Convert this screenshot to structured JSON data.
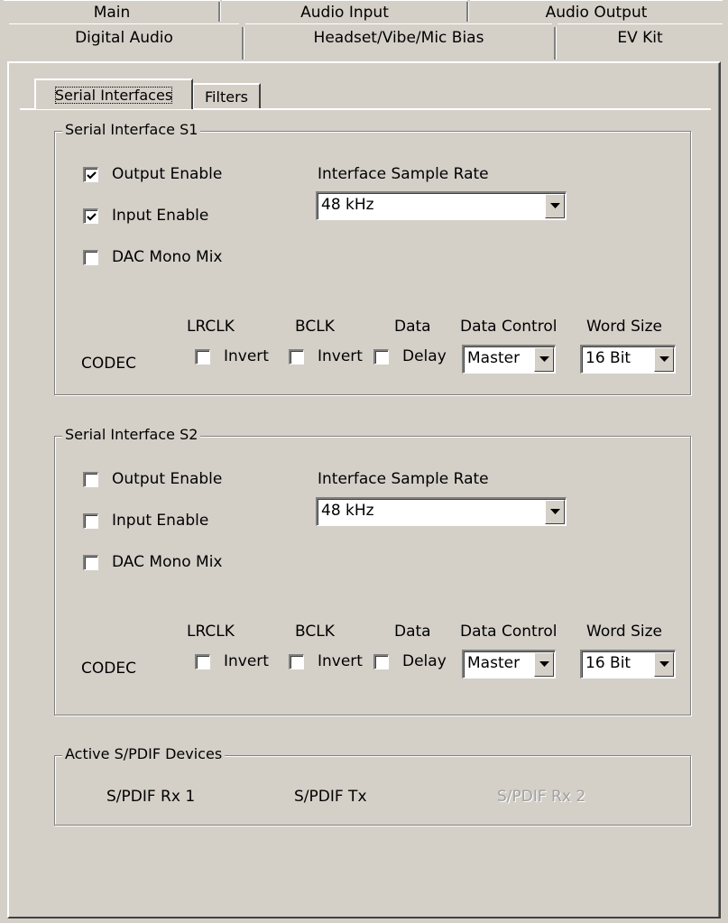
{
  "tabs_row1": [
    "Main",
    "Audio Input",
    "Audio Output"
  ],
  "tabs_row2": [
    "Digital Audio",
    "Headset/Vibe/Mic Bias",
    "EV Kit"
  ],
  "active_tab": "Digital Audio",
  "subtabs": [
    "Serial Interfaces",
    "Filters"
  ],
  "active_subtab": "Serial Interfaces",
  "s1": {
    "title": "Serial Interface  S1",
    "output_enable": {
      "label": "Output Enable",
      "checked": true
    },
    "input_enable": {
      "label": "Input Enable",
      "checked": true
    },
    "dac_mono_mix": {
      "label": "DAC Mono Mix",
      "checked": false
    },
    "sample_rate_label": "Interface Sample Rate",
    "sample_rate": "48 kHz",
    "codec_label": "CODEC",
    "lrclk_label": "LRCLK",
    "lrclk_invert": {
      "label": "Invert",
      "checked": false
    },
    "bclk_label": "BCLK",
    "bclk_invert": {
      "label": "Invert",
      "checked": false
    },
    "data_label": "Data",
    "data_delay": {
      "label": "Delay",
      "checked": false
    },
    "data_control_label": "Data Control",
    "data_control": "Master",
    "word_size_label": "Word Size",
    "word_size": "16 Bit"
  },
  "s2": {
    "title": "Serial Interface  S2",
    "output_enable": {
      "label": "Output Enable",
      "checked": false
    },
    "input_enable": {
      "label": "Input Enable",
      "checked": false
    },
    "dac_mono_mix": {
      "label": "DAC Mono Mix",
      "checked": false
    },
    "sample_rate_label": "Interface Sample Rate",
    "sample_rate": "48 kHz",
    "codec_label": "CODEC",
    "lrclk_label": "LRCLK",
    "lrclk_invert": {
      "label": "Invert",
      "checked": false
    },
    "bclk_label": "BCLK",
    "bclk_invert": {
      "label": "Invert",
      "checked": false
    },
    "data_label": "Data",
    "data_delay": {
      "label": "Delay",
      "checked": false
    },
    "data_control_label": "Data Control",
    "data_control": "Master",
    "word_size_label": "Word Size",
    "word_size": "16 Bit"
  },
  "spdif": {
    "title": "Active S/PDIF Devices",
    "rx1": "S/PDIF Rx 1",
    "tx": "S/PDIF Tx",
    "rx2": "S/PDIF Rx 2",
    "rx2_enabled": false
  },
  "colors": {
    "face": "#d4d0c8",
    "shadow": "#808080",
    "highlight": "#ffffff",
    "disabled_text": "#a0a0a0"
  },
  "icons": {
    "check": "checkmark-icon",
    "dropdown": "chevron-down-icon"
  }
}
